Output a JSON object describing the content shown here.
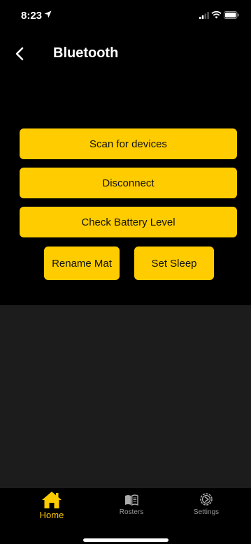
{
  "status_bar": {
    "time": "8:23"
  },
  "header": {
    "title": "Bluetooth"
  },
  "actions": {
    "scan": "Scan for devices",
    "disconnect": "Disconnect",
    "battery": "Check Battery Level",
    "rename": "Rename Mat",
    "sleep": "Set Sleep"
  },
  "tabs": [
    {
      "label": "Home",
      "icon": "home-icon",
      "active": true
    },
    {
      "label": "Rosters",
      "icon": "book-icon",
      "active": false
    },
    {
      "label": "Settings",
      "icon": "gear-icon",
      "active": false
    }
  ],
  "colors": {
    "accent": "#FFCC00",
    "background": "#000000",
    "panel": "#1C1C1C",
    "inactive_tab": "#999999"
  }
}
